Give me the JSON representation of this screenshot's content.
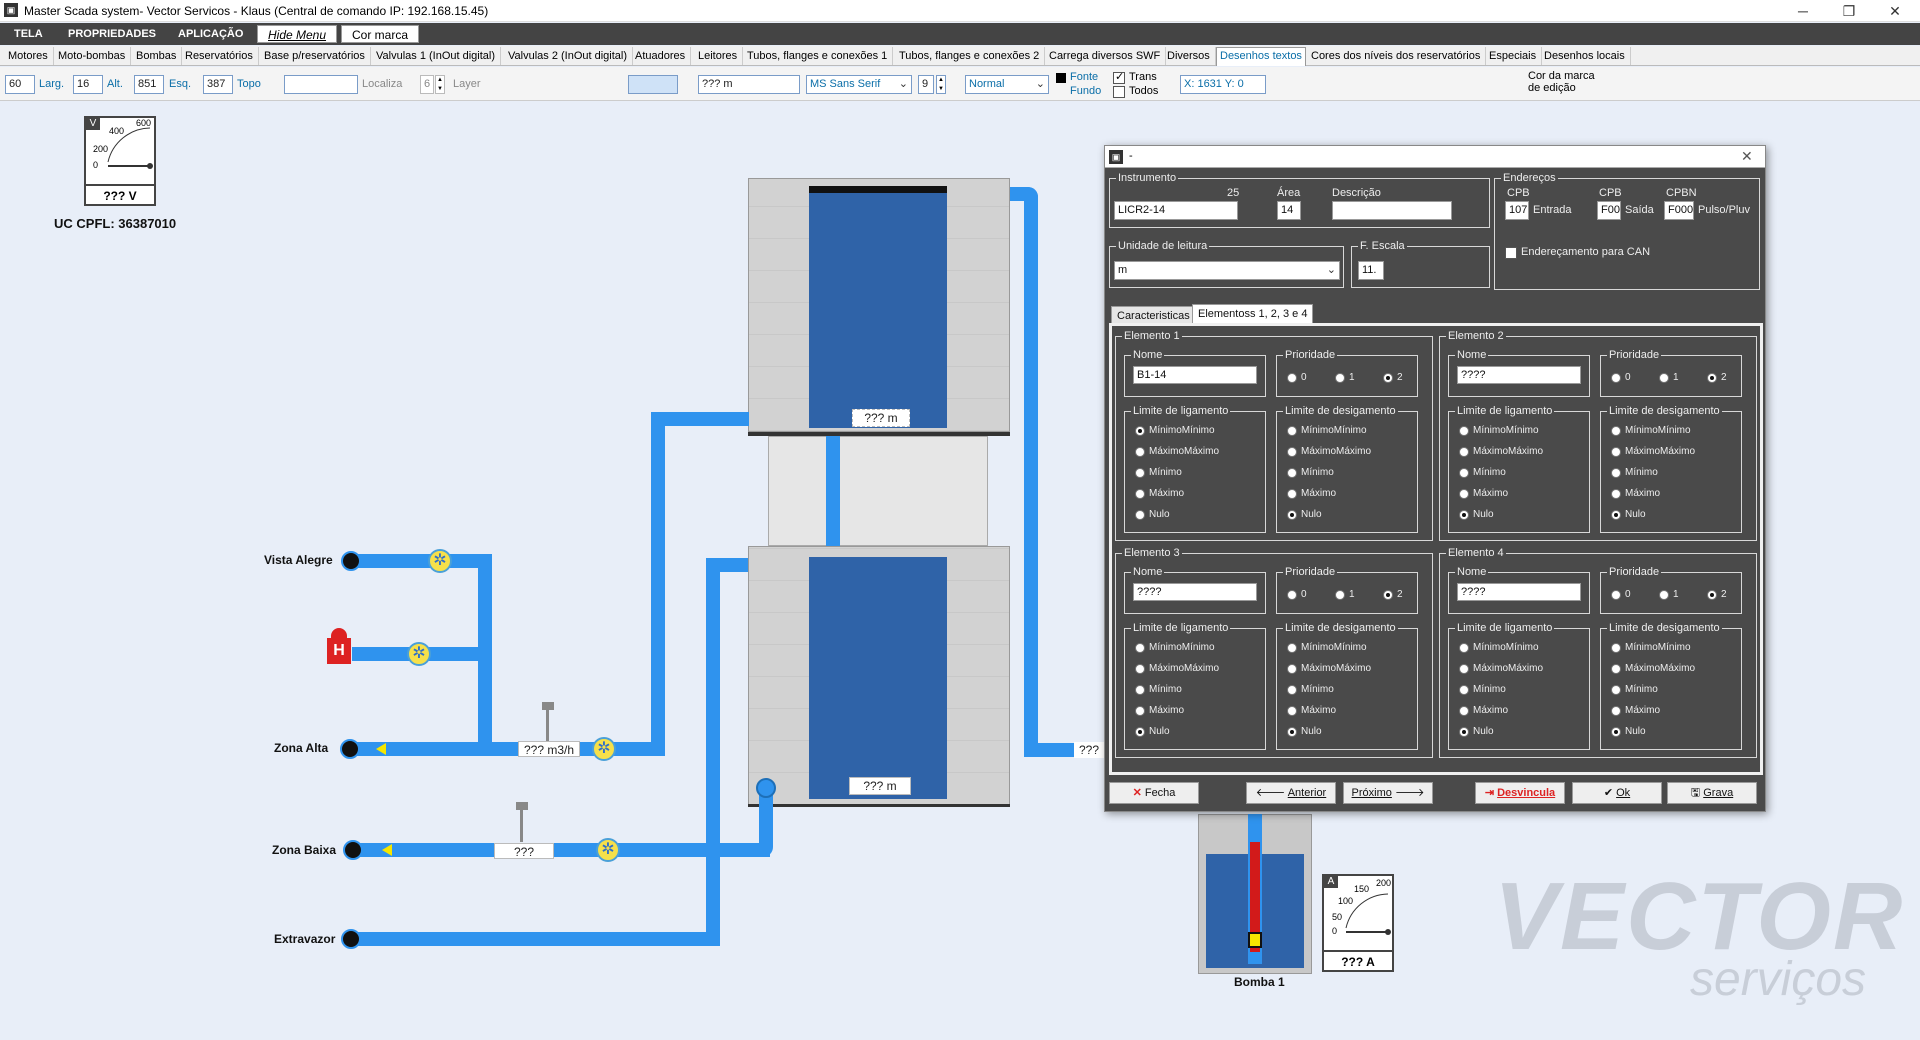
{
  "window": {
    "title": "Master Scada system- Vector Servicos - Klaus   (Central de comando IP: 192.168.15.45)",
    "icon": "app-icon",
    "controls": [
      "─",
      "❐",
      "✕"
    ]
  },
  "menu": {
    "items": [
      "TELA",
      "PROPRIEDADES",
      "APLICAÇÃO"
    ],
    "hide_menu": "Hide Menu",
    "cor_marca": "Cor marca"
  },
  "tabs": [
    "Motores",
    "Moto-bombas",
    "Bombas",
    "Reservatórios",
    "Base p/reservatórios",
    "Valvulas 1 (InOut digital)",
    "Valvulas 2 (InOut digital)",
    "Atuadores",
    "Leitores",
    "Tubos, flanges e conexões 1",
    "Tubos, flanges e conexões 2",
    "Carrega diversos SWF",
    "Diversos",
    "Desenhos textos",
    "Cores dos níveis dos reservatórios",
    "Especiais",
    "Desenhos locais"
  ],
  "tabs_selected": 13,
  "toolbar": {
    "larg_val": "60",
    "larg": "Larg.",
    "alt_val": "16",
    "alt": "Alt.",
    "esq_val": "851",
    "esq": "Esq.",
    "topo_val": "387",
    "topo": "Topo",
    "localiza": "Localiza",
    "layer_val": "6",
    "layer": "Layer",
    "text_val": "??? m",
    "font": "MS Sans Serif",
    "font_size": "9",
    "style": "Normal",
    "fonte": "Fonte",
    "fundo": "Fundo",
    "trans": "Trans",
    "todos": "Todos",
    "coords": "X: 1631  Y: 0",
    "cor_marca_1": "Cor da marca",
    "cor_marca_2": "de edição"
  },
  "canvas": {
    "gauge_v": {
      "unit": "V",
      "ticks": [
        "600",
        "400",
        "200",
        "0"
      ],
      "value": "??? V"
    },
    "uc": "UC CPFL: 36387010",
    "labels": {
      "vista_alegre": "Vista Alegre",
      "zona_alta": "Zona Alta",
      "zona_baixa": "Zona Baixa",
      "extravazor": "Extravazor",
      "bomba": "Bomba 1"
    },
    "flow1": "??? m3/h",
    "flow2": "???",
    "level_top": "??? m",
    "level_bottom": "??? m",
    "right_pipe": "???",
    "gauge_a": {
      "unit": "A",
      "ticks": [
        "200",
        "150",
        "100",
        "50",
        "0"
      ],
      "value": "??? A"
    },
    "logo_1": "VECTOR",
    "logo_2": "serviços"
  },
  "dialog": {
    "title": "-",
    "instrumento": {
      "title": "Instrumento",
      "num": "25",
      "value": "LICR2-14",
      "area_l": "Área",
      "area": "14",
      "desc_l": "Descrição",
      "desc": ""
    },
    "enderecos": {
      "title": "Endereços",
      "cpb1": "CPB",
      "v1": "107",
      "entrada": "Entrada",
      "cpb2": "CPB",
      "v2": "F00",
      "saida": "Saída",
      "cpbn": "CPBN",
      "v3": "F000",
      "pulso": "Pulso/Pluv",
      "can": "Endereçamento para CAN"
    },
    "unidade": {
      "title": "Unidade de leitura",
      "value": "m"
    },
    "escala": {
      "title": "F. Escala",
      "value": "11."
    },
    "tabs": [
      "Caracteristicas",
      "Elementoss 1, 2, 3 e 4"
    ],
    "elementos": [
      {
        "title": "Elemento 1",
        "nome": "B1-14",
        "prio_sel": 2,
        "lig_sel": 0,
        "des_sel": 4
      },
      {
        "title": "Elemento 2",
        "nome": "????",
        "prio_sel": 2,
        "lig_sel": 4,
        "des_sel": 4
      },
      {
        "title": "Elemento 3",
        "nome": "????",
        "prio_sel": 2,
        "lig_sel": 4,
        "des_sel": 4
      },
      {
        "title": "Elemento 4",
        "nome": "????",
        "prio_sel": 2,
        "lig_sel": 4,
        "des_sel": 4
      }
    ],
    "nome_label": "Nome",
    "prio_label": "Prioridade",
    "prio_opts": [
      "0",
      "1",
      "2"
    ],
    "lig_label": "Limite de ligamento",
    "des_label": "Limite de desigamento",
    "limit_opts": [
      "MínimoMínimo",
      "MáximoMáximo",
      "Mínimo",
      "Máximo",
      "Nulo"
    ],
    "buttons": {
      "fecha": "Fecha",
      "anterior": "Anterior",
      "proximo": "Próximo",
      "desvincula": "Desvincula",
      "ok": "Ok",
      "grava": "Grava"
    }
  }
}
